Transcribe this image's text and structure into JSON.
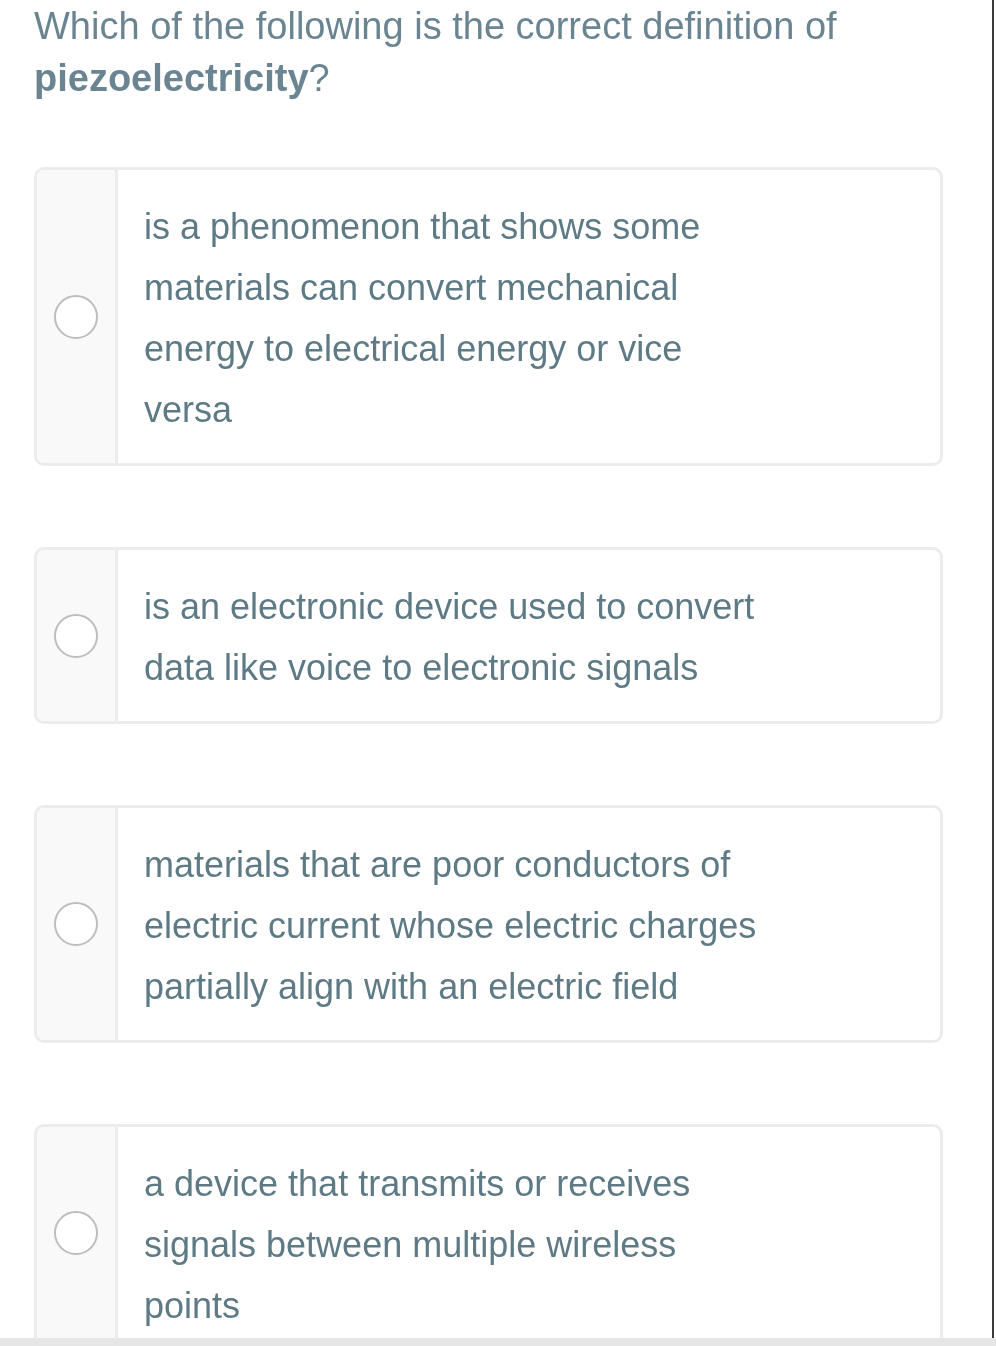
{
  "question": "Which of the following is the correct definition of **piezoelectricity**?",
  "options": [
    {
      "text": "is a phenomenon that shows some materials can convert mechanical energy to electrical energy or vice versa",
      "selected": false
    },
    {
      "text": "is an electronic device used to convert data like voice to electronic signals",
      "selected": false
    },
    {
      "text": "materials that are poor conductors of electric current whose electric charges partially align with an electric field",
      "selected": false
    },
    {
      "text": "a device that transmits or receives signals between multiple wireless points",
      "selected": false
    }
  ]
}
